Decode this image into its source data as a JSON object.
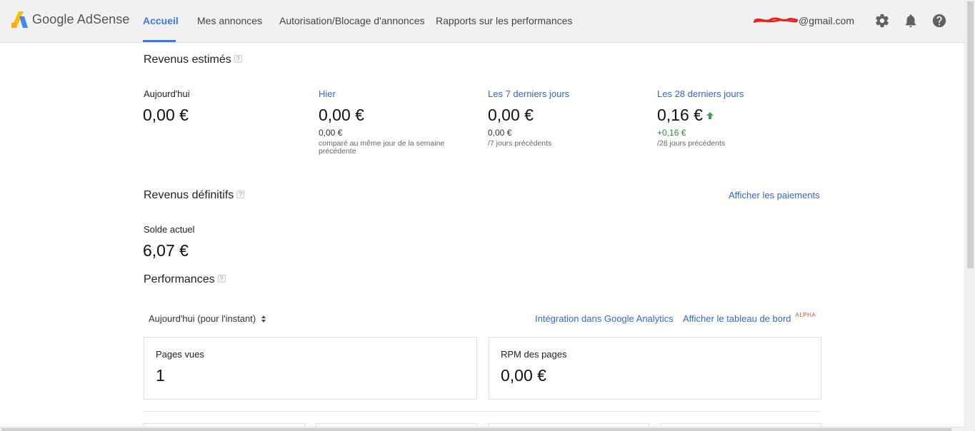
{
  "header": {
    "brand": "Google AdSense",
    "nav": [
      {
        "label": "Accueil",
        "active": true
      },
      {
        "label": "Mes annonces",
        "active": false
      },
      {
        "label": "Autorisation/Blocage d'annonces",
        "active": false
      },
      {
        "label": "Rapports sur les performances",
        "active": false
      }
    ],
    "account_suffix": "@gmail.com",
    "icons": [
      "settings-gear-icon",
      "notifications-bell-icon",
      "help-icon"
    ],
    "accent_color": "#3b78e7"
  },
  "estimated": {
    "title": "Revenus estimés",
    "help": "?",
    "metrics": [
      {
        "label": "Aujourd'hui",
        "value": "0,00 €"
      },
      {
        "label": "Hier",
        "value": "0,00 €",
        "compare_value": "0,00 €",
        "compare_note": "comparé au même jour de la semaine précédente"
      },
      {
        "label": "Les 7 derniers jours",
        "value": "0,00 €",
        "compare_value": "0,00 €",
        "compare_note": "/7 jours précédents"
      },
      {
        "label": "Les 28 derniers jours",
        "value": "0,16 €",
        "compare_value": "+0,16 €",
        "compare_note": "/28 jours précédents",
        "trend": "up"
      }
    ]
  },
  "final": {
    "title": "Revenus définitifs",
    "help": "?",
    "payments_link": "Afficher les paiements",
    "balance_label": "Solde actuel",
    "balance_value": "6,07 €"
  },
  "performance": {
    "title": "Performances",
    "help": "?",
    "period_select": "Aujourd'hui (pour l'instant)",
    "analytics_link": "Intégration dans Google Analytics",
    "dashboard_link": "Afficher le tableau de bord",
    "dashboard_badge": "ALPHA",
    "cards": [
      {
        "title": "Pages vues",
        "value": "1"
      },
      {
        "title": "RPM des pages",
        "value": "0,00 €"
      }
    ]
  }
}
